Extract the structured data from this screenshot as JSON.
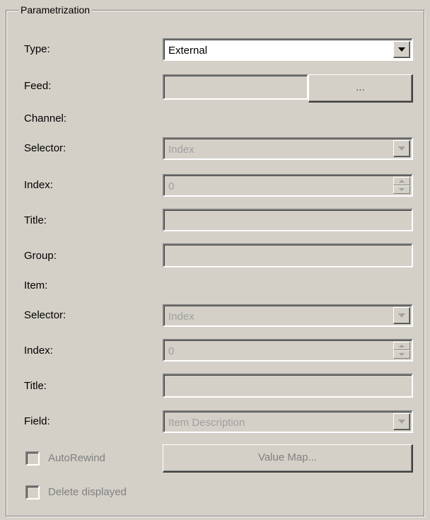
{
  "group": {
    "title": "Parametrization"
  },
  "type": {
    "label": "Type:",
    "value": "External"
  },
  "feed": {
    "label": "Feed:",
    "value": "",
    "browse_label": "..."
  },
  "channel": {
    "header": "Channel:",
    "selector": {
      "label": "Selector:",
      "value": "Index"
    },
    "index": {
      "label": "Index:",
      "value": "0"
    },
    "title": {
      "label": "Title:",
      "value": ""
    },
    "group": {
      "label": "Group:",
      "value": ""
    }
  },
  "item": {
    "header": "Item:",
    "selector": {
      "label": "Selector:",
      "value": "Index"
    },
    "index": {
      "label": "Index:",
      "value": "0"
    },
    "title": {
      "label": "Title:",
      "value": ""
    },
    "field": {
      "label": "Field:",
      "value": "Item Description"
    }
  },
  "options": {
    "autorewind_label": "AutoRewind",
    "autorewind_checked": false,
    "delete_displayed_label": "Delete displayed",
    "delete_displayed_checked": false,
    "value_map_label": "Value Map..."
  },
  "colors": {
    "face": "#d4d0c8",
    "disabled_text": "#808080",
    "shadow": "#808080",
    "highlight": "#ffffff"
  },
  "icons": [
    "dropdown-arrow-icon",
    "spin-up-icon",
    "spin-down-icon",
    "checkbox-icon"
  ]
}
